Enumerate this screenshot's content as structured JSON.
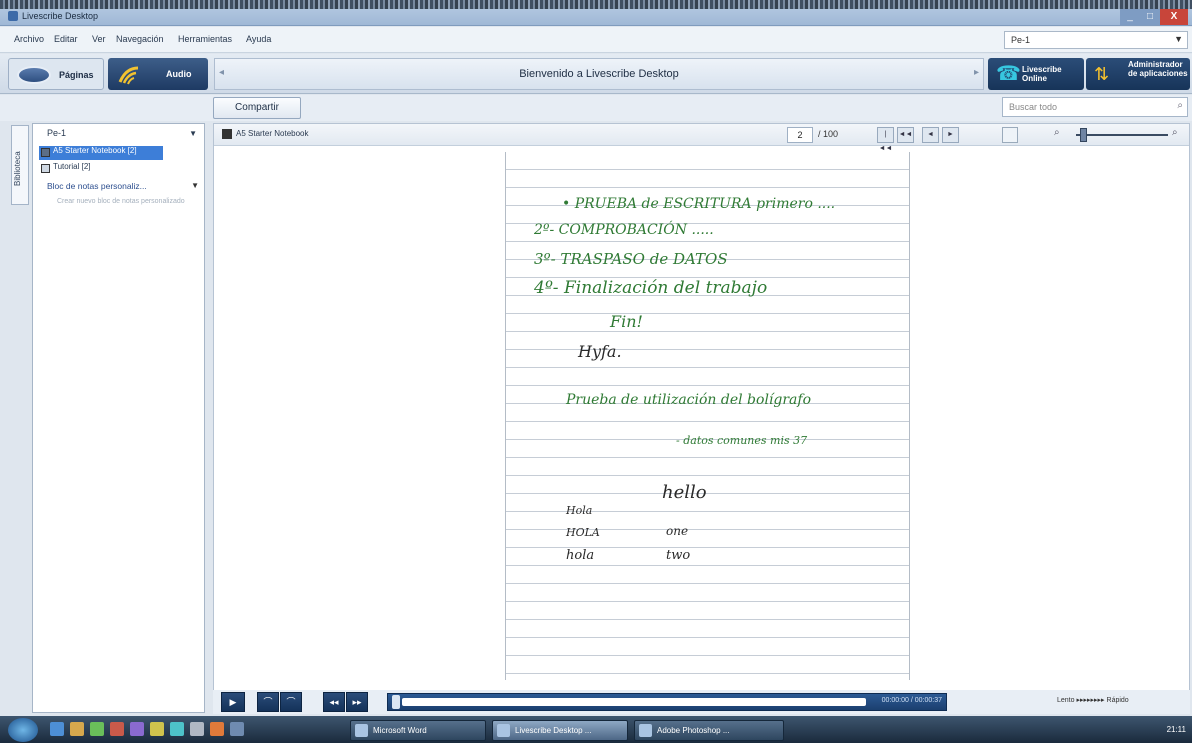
{
  "window": {
    "title": "Livescribe Desktop",
    "minimize": "_",
    "maximize": "□",
    "close": "X"
  },
  "menu": {
    "items": [
      "Archivo",
      "Editar",
      "Ver",
      "Navegación",
      "Herramientas",
      "Ayuda"
    ],
    "pen_filter": "Pe-1"
  },
  "toolbar": {
    "pages_label": "Páginas",
    "audio_label": "Audio",
    "welcome": "Bienvenido a Livescribe Desktop",
    "online_label": "Livescribe Online",
    "app_manager_label": "Administrador de aplicaciones"
  },
  "share_label": "Compartir",
  "search": {
    "placeholder": "Buscar todo"
  },
  "library": {
    "tab_label": "Biblioteca",
    "pen": "Pe-1",
    "notebooks": [
      {
        "label": "A5 Starter Notebook [2]"
      },
      {
        "label": "Tutorial [2]"
      }
    ],
    "custom_notebooks": "Bloc de notas personaliz...",
    "create_hint": "Crear nuevo bloc de notas personalizado"
  },
  "page_header": {
    "notebook_name": "A5 Starter Notebook",
    "page_number": "2",
    "page_total": "/ 100",
    "nav": [
      "|◄◄",
      "◄◄",
      "◄",
      "►"
    ]
  },
  "handwriting": [
    {
      "text": "• PRUEBA de ESCRITURA primero ....",
      "color": "#2f7a34"
    },
    {
      "text": "2º- COMPROBACIÓN .....",
      "color": "#2f7a34"
    },
    {
      "text": "3º- TRASPASO de DATOS",
      "color": "#2f7a34"
    },
    {
      "text": "4º- Finalización del trabajo",
      "color": "#2f7a34"
    },
    {
      "text": "Fin!",
      "color": "#2f7a34"
    },
    {
      "text": "Hyfa.",
      "color": "#2a2a2a"
    },
    {
      "text": "Prueba de utilización del bolígrafo",
      "color": "#2f7a34"
    },
    {
      "text": "- datos comunes mis 37",
      "color": "#2f7a34"
    },
    {
      "text": "hello",
      "color": "#2a2a2a"
    },
    {
      "text": "Hola",
      "color": "#2a2a2a"
    },
    {
      "text": "HOLA",
      "color": "#2a2a2a"
    },
    {
      "text": "one",
      "color": "#2a2a2a"
    },
    {
      "text": "hola",
      "color": "#2a2a2a"
    },
    {
      "text": "two",
      "color": "#2a2a2a"
    }
  ],
  "player": {
    "time": "00:00:00 / 00:00:37",
    "speed": "Lento ▸▸▸▸▸▸▸▸ Rápido"
  },
  "taskbar": {
    "items": [
      "Microsoft Word",
      "Livescribe Desktop ...",
      "Adobe Photoshop ..."
    ],
    "clock": "21:11"
  }
}
